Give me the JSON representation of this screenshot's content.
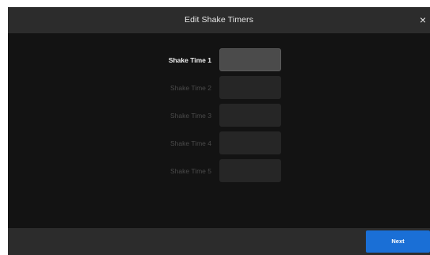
{
  "dialog": {
    "title": "Edit Shake Timers",
    "close_icon": "close-icon",
    "close_glyph": "×"
  },
  "timers": [
    {
      "label": "Shake Time 1",
      "value": "",
      "active": true
    },
    {
      "label": "Shake Time 2",
      "value": "",
      "active": false
    },
    {
      "label": "Shake Time 3",
      "value": "",
      "active": false
    },
    {
      "label": "Shake Time 4",
      "value": "",
      "active": false
    },
    {
      "label": "Shake Time 5",
      "value": "",
      "active": false
    }
  ],
  "footer": {
    "next_label": "Next"
  },
  "colors": {
    "background": "#131313",
    "bar": "#2c2c2c",
    "accent": "#1a6fd6",
    "active_field": "#4b4b4b",
    "inactive_field": "#262626"
  }
}
